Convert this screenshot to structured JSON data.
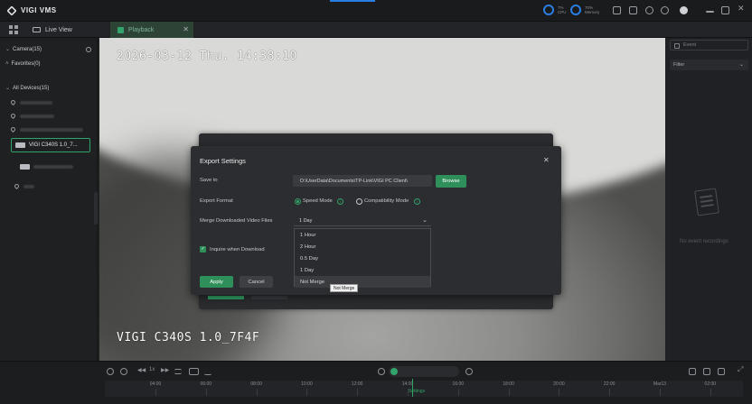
{
  "app": {
    "name": "VIGI VMS"
  },
  "titlebar": {
    "cpu": {
      "value": "7%",
      "label": "CPU"
    },
    "memory": {
      "value": "70%",
      "label": "Memory"
    }
  },
  "tabs": [
    {
      "label": "Live View"
    },
    {
      "label": "Playback"
    }
  ],
  "sidebar": {
    "camera_header": "Camera(15)",
    "favorites": "Favorites(0)",
    "all_devices": "All Devices(15)",
    "selected_device": "VIGI C340S 1.0_7..."
  },
  "video": {
    "timestamp": "2026-03-12 Thu. 14:38:10",
    "camera_name": "VIGI C340S 1.0_7F4F"
  },
  "right_panel": {
    "event_placeholder": "Event",
    "filter_label": "Filter",
    "empty_text": "No event recordings"
  },
  "timeline": {
    "ticks": [
      "04:00",
      "06:00",
      "08:00",
      "10:00",
      "12:00",
      "14:00",
      "16:00",
      "18:00",
      "20:00",
      "22:00",
      "Mar13",
      "02:00"
    ],
    "cursor_label": "Settings"
  },
  "dialog": {
    "title": "Export Settings",
    "save_to_label": "Save to",
    "save_path": "D:\\UserData\\Documents\\TP-Link\\VIGI PC Client\\",
    "browse_label": "Browse",
    "format_label": "Export Format",
    "format_options": [
      "Speed Mode",
      "Compatibility Mode"
    ],
    "format_selected": "Speed Mode",
    "merge_label": "Merge Downloaded Video Files",
    "merge_value": "1 Day",
    "inquire_label": "Inquire when Download",
    "inquire_checked": true,
    "apply_label": "Apply",
    "cancel_label": "Cancel"
  },
  "merge_dropdown": {
    "options": [
      "1 Hour",
      "2 Hour",
      "0.5 Day",
      "1 Day",
      "Not Merge"
    ],
    "hovered": "Not Merge",
    "tooltip": "Not Merge"
  },
  "colors": {
    "accent": "#32a36a",
    "button": "#2e8f5b",
    "dialog_bg": "#2c2d30",
    "blue": "#2a7de1"
  }
}
